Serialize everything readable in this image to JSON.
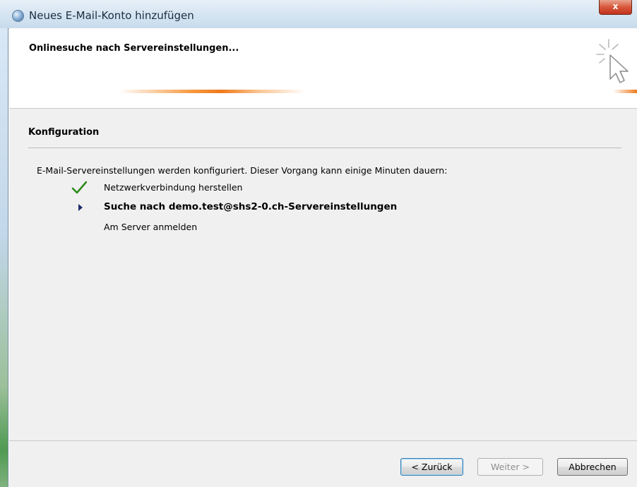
{
  "window": {
    "title": "Neues E-Mail-Konto hinzufügen",
    "close_label": "x"
  },
  "header": {
    "title": "Onlinesuche nach Servereinstellungen..."
  },
  "section": {
    "title": "Konfiguration",
    "description": "E-Mail-Servereinstellungen werden konfiguriert. Dieser Vorgang kann einige Minuten dauern:"
  },
  "steps": [
    {
      "label": "Netzwerkverbindung herstellen",
      "status": "done",
      "icon": "checkmark-icon"
    },
    {
      "label": "Suche nach demo.test@shs2-0.ch-Servereinstellungen",
      "status": "active",
      "icon": "arrow-right-icon"
    },
    {
      "label": "Am Server anmelden",
      "status": "pending",
      "icon": "none"
    }
  ],
  "buttons": {
    "back": "< Zurück",
    "next": "Weiter >",
    "cancel": "Abbrechen"
  },
  "colors": {
    "accent_orange": "#ef7a1c",
    "check_green": "#2f8a1f",
    "arrow_navy": "#1f2c6b",
    "close_red": "#c7381c"
  }
}
